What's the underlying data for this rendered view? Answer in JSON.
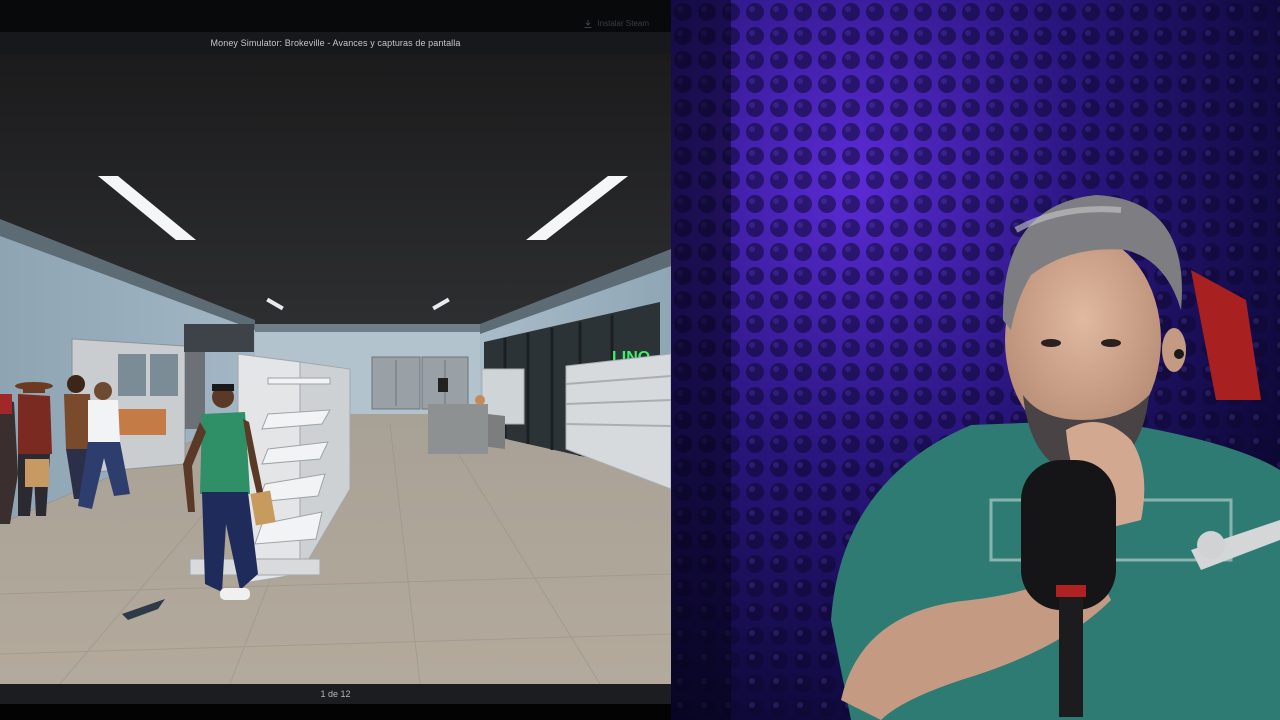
{
  "window": {
    "title": "Money Simulator: Brokeville - Avances y capturas de pantalla",
    "install_label": "Instalar Steam"
  },
  "viewer": {
    "counter": "1 de 12"
  },
  "scene": {
    "neon_sign": "LINO"
  },
  "colors": {
    "viewer_bg": "#050506",
    "title_bar": "#16181c",
    "counter_bar": "#1b1d21",
    "webcam_glow": "#5b2bd6"
  },
  "icons": {
    "install": "download-icon"
  }
}
